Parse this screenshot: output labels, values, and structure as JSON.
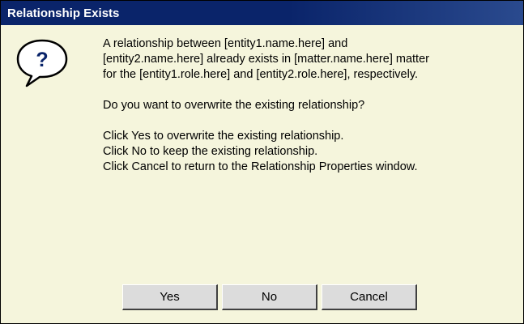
{
  "dialog": {
    "title": "Relationship Exists",
    "icon": "question-icon",
    "message_line1": "A relationship between [entity1.name.here] and",
    "message_line2": "[entity2.name.here] already exists in [matter.name.here] matter",
    "message_line3": "for the [entity1.role.here] and [entity2.role.here], respectively.",
    "question": "Do you want to overwrite the existing relationship?",
    "instruction_yes": "Click Yes to overwrite the existing relationship.",
    "instruction_no": "Click No to keep the existing relationship.",
    "instruction_cancel": "Click Cancel to return to the Relationship Properties window."
  },
  "buttons": {
    "yes_label": "Yes",
    "no_label": "No",
    "cancel_label": "Cancel"
  },
  "colors": {
    "title_bar": "#0a246a",
    "title_text": "#ffffff",
    "dialog_bg": "#f5f5dc",
    "button_bg": "#dcdcdc",
    "icon_mark": "#0a246a"
  }
}
